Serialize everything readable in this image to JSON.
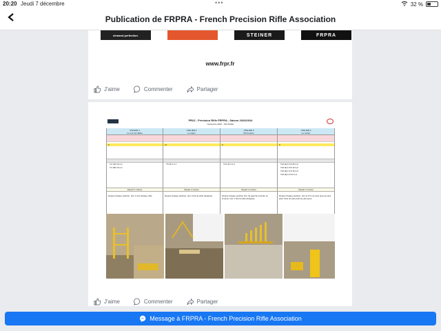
{
  "status_bar": {
    "time": "20:20",
    "date": "Jeudi 7 décembre",
    "battery": "32 %",
    "battery_level": 0.32
  },
  "nav": {
    "back_icon": "chevron-left-icon",
    "title": "Publication de FRPRA - French Precision Rifle Association"
  },
  "post1": {
    "banners": [
      "demand perfection.",
      "",
      "STEINER",
      "FRPRA"
    ],
    "site_url": "www.frpr.fr"
  },
  "actions": {
    "like": "J'aime",
    "comment": "Commenter",
    "share": "Partager"
  },
  "document": {
    "title": "PR22 - Précision Rifle FRPRA - Saison 2023/2024",
    "subtitle": "Novembre 2023 - TAUTAVEL",
    "columns": [
      {
        "header": "ATELIER 1",
        "name": "Le mur de Hilaire",
        "points": "8",
        "rows": [
          "T2   130   16   2,4",
          "T3   190   16   2,4"
        ],
        "separator": "Départ 2 mètres",
        "description": "Depuis chaque position, tirer 1 fois chaque cible"
      },
      {
        "header": "ATELIER 2",
        "name": "Le sapin",
        "points": "12",
        "rows": [
          "T5   36   2   2,7"
        ],
        "separator": "Départ 2 mètres",
        "description": "Depuis chaque position, tirer 3 fois la cible désignée"
      },
      {
        "header": "ATELIER 3",
        "name": "Rich Lamie",
        "points": "8",
        "rows": [
          "T12   33   3   2,4"
        ],
        "separator": "Départ 2 mètres",
        "description": "Depuis chaque position tirer de gauche à droite ou inverse, tirer 1 fois la cible désignée"
      },
      {
        "header": "ATELIER 4",
        "name": "Le rocher",
        "points": "8",
        "rows": [
          "T10 Rpf   170   26   4,0",
          "T10 Rpf   176   16   3,0",
          "T10 Rpf   170   16   2,0",
          "T10 Rpf   170   6   1,0"
        ],
        "separator": "Départ 2 mètres",
        "description": "Depuis chaque position, tirer le KYL du plus gros au plus petit. Plus du plus petit au plus gros"
      }
    ]
  },
  "messenger": {
    "label": "Message à FRPRA - French Precision Rifle Association"
  }
}
